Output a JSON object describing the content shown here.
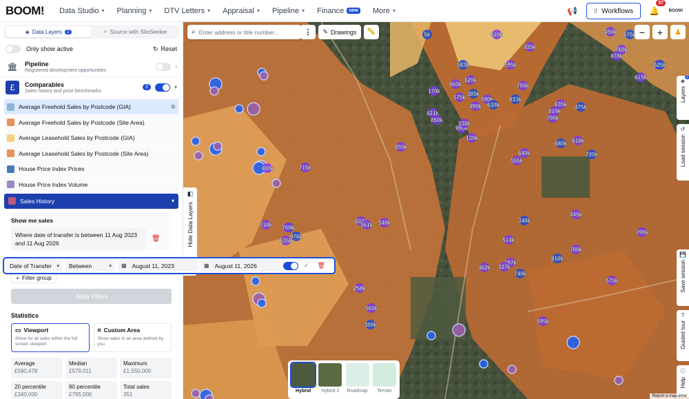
{
  "nav": {
    "logo": "BOOM!",
    "items": [
      {
        "label": "Data Studio"
      },
      {
        "label": "Planning"
      },
      {
        "label": "DTV Letters"
      },
      {
        "label": "Appraisal"
      },
      {
        "label": "Pipeline"
      },
      {
        "label": "Finance",
        "badge": "new"
      },
      {
        "label": "More"
      }
    ],
    "workflows_label": "Workflows",
    "notifications_count": "37",
    "avatar_text": "BOOM!"
  },
  "sidebar": {
    "tabs": [
      {
        "label": "Data Layers",
        "count": "2"
      },
      {
        "label": "Source with SiteSeeker"
      }
    ],
    "only_show_active": "Only show active",
    "reset": "Reset",
    "pipeline": {
      "title": "Pipeline",
      "subtitle": "Registered development opportunities"
    },
    "comparables": {
      "title": "Comparables",
      "subtitle": "Sales history and price benchmarks",
      "count": "2"
    },
    "sublayers": [
      {
        "label": "Average Freehold Sales by Postcode (GIA)",
        "color": "#8fb3dd"
      },
      {
        "label": "Average Freehold Sales by Postcode (Site Area)",
        "color": "#e8915a"
      },
      {
        "label": "Average Leasehold Sales by Postcode (GIA)",
        "color": "#f3d27a"
      },
      {
        "label": "Average Leasehold Sales by Postcode (Site Area)",
        "color": "#e8915a"
      },
      {
        "label": "House Price Index Prices",
        "color": "#4a7bb7"
      },
      {
        "label": "House Price Index Volume",
        "color": "#9d87c9"
      }
    ],
    "sales_history": {
      "label": "Sales History",
      "color": "#b65a7a"
    },
    "show_me_sales": "Show me sales",
    "condition_text": "Where date of transfer is between 11 Aug 2023 and 11 Aug 2026",
    "add_filter_group": "Filter group",
    "apply_filters": "Apply Filters",
    "statistics": "Statistics",
    "modes": [
      {
        "title": "Viewport",
        "desc": "Show for all sales within the full screen viewport"
      },
      {
        "title": "Custom Area",
        "desc": "Show sales in an area defined by you"
      }
    ],
    "stats": [
      {
        "k": "Average",
        "v": "£590,478"
      },
      {
        "k": "Median",
        "v": "£579,011"
      },
      {
        "k": "Maximum",
        "v": "£1,550,000"
      },
      {
        "k": "20 percentile",
        "v": "£340,000"
      },
      {
        "k": "80 percentile",
        "v": "£795,000"
      },
      {
        "k": "Total sales",
        "v": "351"
      }
    ]
  },
  "filterbar": {
    "field": "Date of Transfer",
    "operator": "Between",
    "from": "August 11, 2023",
    "to": "August 11, 2026"
  },
  "map": {
    "search_placeholder": "Enter address or title number...",
    "drawings": "Drawings",
    "hide_layers": "Hide Data Layers",
    "right_tabs": [
      {
        "label": "Layers",
        "count": "2"
      },
      {
        "label": "Load session"
      },
      {
        "label": "Save session"
      },
      {
        "label": "Guided tour"
      },
      {
        "label": "Help"
      }
    ],
    "basemaps": [
      {
        "label": "Hybrid"
      },
      {
        "label": "Hybrid 2"
      },
      {
        "label": "Roadmap"
      },
      {
        "label": "Terrain"
      }
    ],
    "report": "Report a map error",
    "markers": [
      "5k",
      "510k",
      "435k",
      "450k",
      "675k",
      "760k",
      "878k",
      "185k",
      "583k",
      "660k",
      "575k",
      "620k",
      "385k",
      "595k",
      "700k",
      "615k",
      "525k",
      "170k",
      "590k",
      "490k",
      "833k",
      "621k",
      "850k",
      "990k",
      "630k",
      "635k",
      "810k",
      "700k",
      "475k",
      "338k",
      "130k",
      "855k",
      "680k",
      "618k",
      "640k",
      "555k",
      "720k",
      "400k",
      "715k",
      "718k",
      "310k",
      "607k",
      "561k",
      "700k",
      "976k",
      "635k",
      "540k",
      "514k",
      "340k",
      "445k",
      "790k",
      "700k",
      "810k",
      "697k",
      "327k",
      "462k",
      "740k",
      "575k",
      "258k",
      "565k",
      "300k",
      "595k"
    ]
  }
}
